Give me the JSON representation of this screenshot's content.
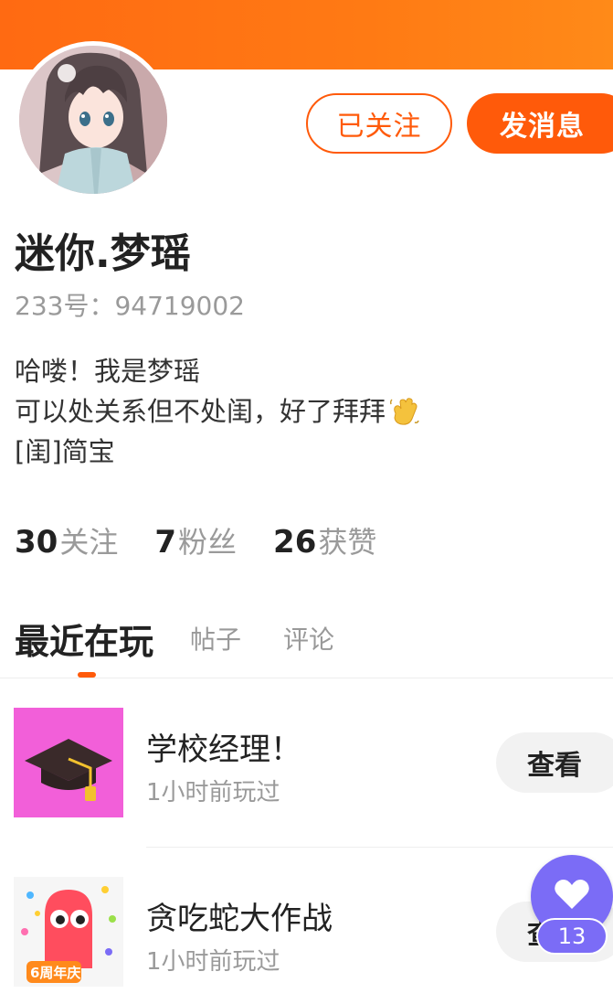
{
  "profile": {
    "name": "迷你.梦瑶",
    "id_text": "233号：94719002",
    "bio_lines": [
      "哈喽！我是梦瑶",
      "可以处关系但不处闺，好了拜拜",
      "[闺]简宝"
    ],
    "bio_emoji_icon": "waving-hand-icon"
  },
  "actions": {
    "follow_label": "已关注",
    "message_label": "发消息"
  },
  "stats": {
    "following_count": "30",
    "following_label": "关注",
    "fans_count": "7",
    "fans_label": "粉丝",
    "likes_count": "26",
    "likes_label": "获赞"
  },
  "tabs": [
    {
      "label": "最近在玩",
      "active": true
    },
    {
      "label": "帖子",
      "active": false
    },
    {
      "label": "评论",
      "active": false
    }
  ],
  "games": [
    {
      "title": "学校经理！",
      "time": "1小时前玩过",
      "button": "查看",
      "icon": "graduation-cap-icon"
    },
    {
      "title": "贪吃蛇大作战",
      "time": "1小时前玩过",
      "button": "查看",
      "icon": "snake-game-icon",
      "badge_text": "6周年庆"
    }
  ],
  "like_fab": {
    "count": "13",
    "icon": "heart-icon"
  },
  "colors": {
    "accent": "#ff5a0a",
    "banner": "#ff7a14",
    "like_fab": "#7b6cf6",
    "muted_text": "#9a9a9a"
  }
}
